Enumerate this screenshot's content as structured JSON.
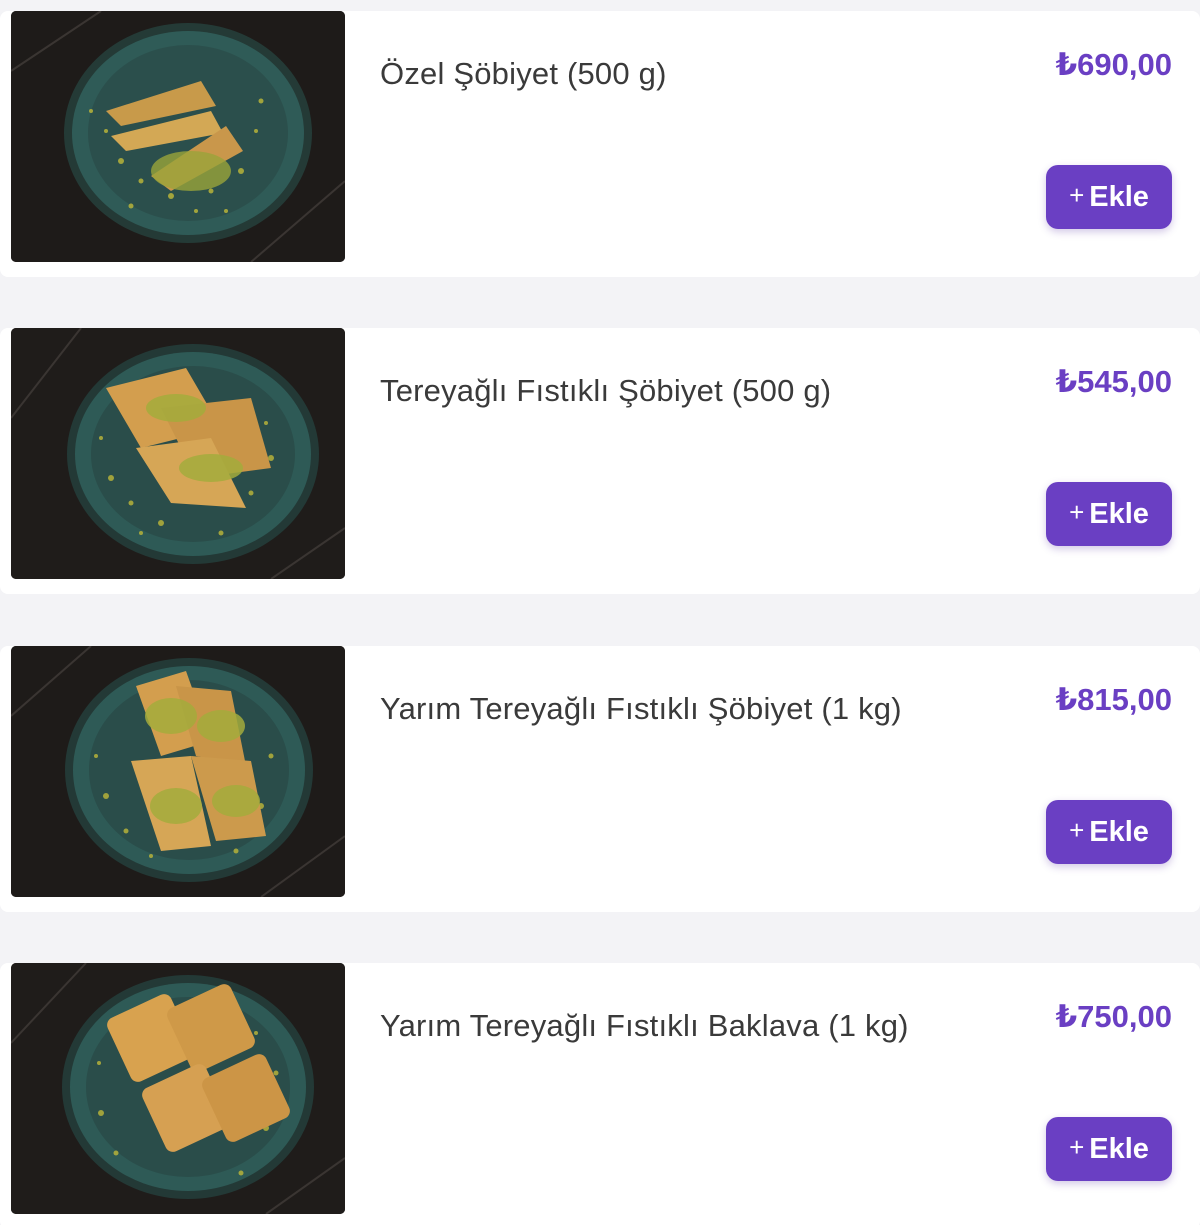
{
  "accent_color": "#6a3fc3",
  "products": [
    {
      "name": "Özel Şöbiyet (500 g)",
      "price": "₺690,00",
      "add_label": "Ekle",
      "add_icon": "plus-icon"
    },
    {
      "name": "Tereyağlı Fıstıklı Şöbiyet (500 g)",
      "price": "₺545,00",
      "add_label": "Ekle",
      "add_icon": "plus-icon"
    },
    {
      "name": "Yarım Tereyağlı Fıstıklı Şöbiyet (1 kg)",
      "price": "₺815,00",
      "add_label": "Ekle",
      "add_icon": "plus-icon"
    },
    {
      "name": "Yarım Tereyağlı Fıstıklı Baklava (1 kg)",
      "price": "₺750,00",
      "add_label": "Ekle",
      "add_icon": "plus-icon"
    }
  ]
}
